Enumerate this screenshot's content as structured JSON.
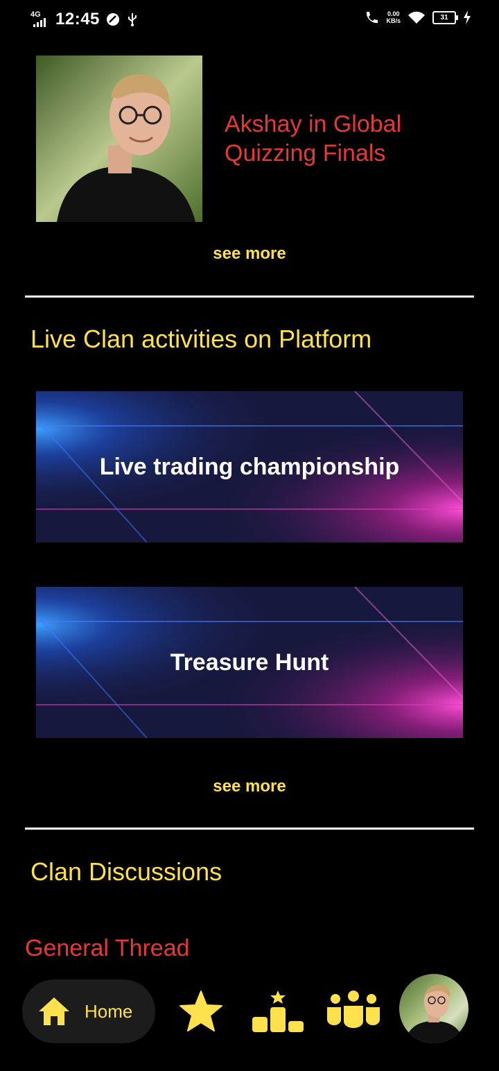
{
  "status_bar": {
    "network": "4G",
    "time": "12:45",
    "speed_value": "0.00",
    "speed_unit": "KB/s",
    "battery": "31"
  },
  "news": {
    "headline": "Akshay in Global Quizzing Finals",
    "see_more": "see more"
  },
  "activities": {
    "title": "Live Clan activities on Platform",
    "items": [
      {
        "label": "Live trading championship"
      },
      {
        "label": "Treasure Hunt"
      }
    ],
    "see_more": "see more"
  },
  "discussions": {
    "title": "Clan Discussions",
    "thread": "General Thread"
  },
  "bottom_nav": {
    "home_label": "Home",
    "icons": [
      "home-icon",
      "star-icon",
      "leaderboard-icon",
      "clan-icon",
      "profile-avatar"
    ]
  },
  "colors": {
    "accent_yellow": "#ffe14d",
    "accent_red": "#e53935",
    "background": "#000000"
  }
}
